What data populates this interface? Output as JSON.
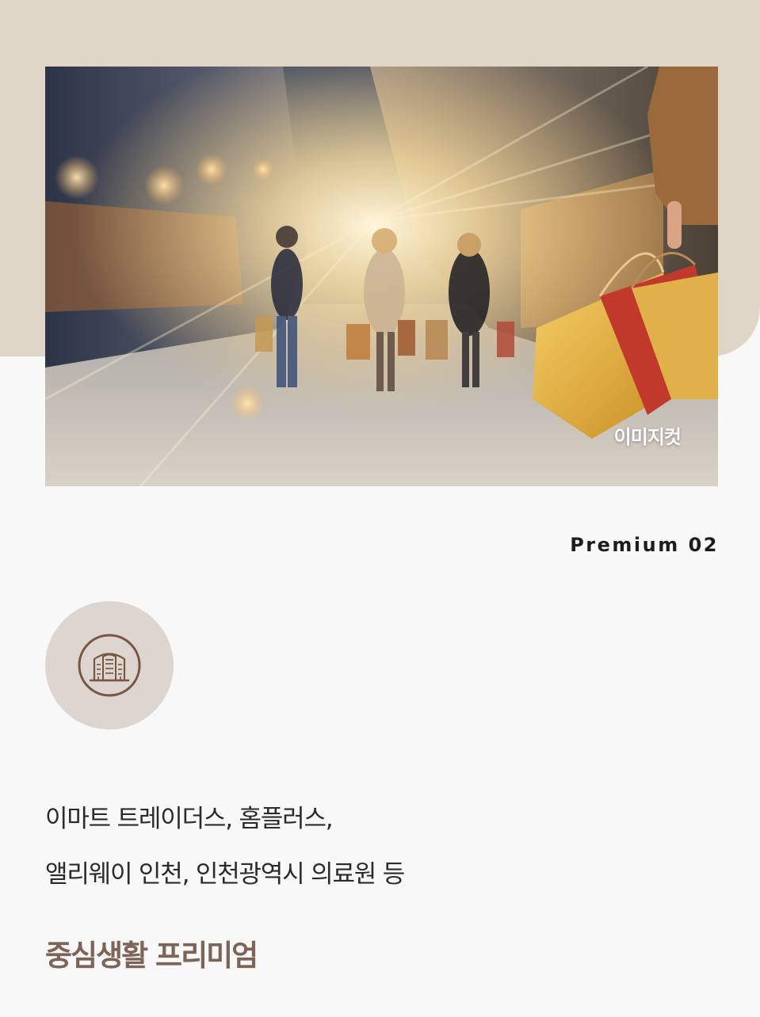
{
  "hero": {
    "watermark": "이미지컷"
  },
  "section": {
    "label": "Premium 02",
    "icon": "department-store-icon",
    "description_lines": [
      "이마트 트레이더스, 홈플러스,",
      "앨리웨이 인천, 인천광역시 의료원 등"
    ],
    "headline": "중심생활 프리미엄"
  },
  "colors": {
    "beige_panel": "#e0d6c8",
    "icon_circle": "#ddd5d0",
    "icon_stroke": "#7a5640",
    "headline": "#7e6456"
  }
}
